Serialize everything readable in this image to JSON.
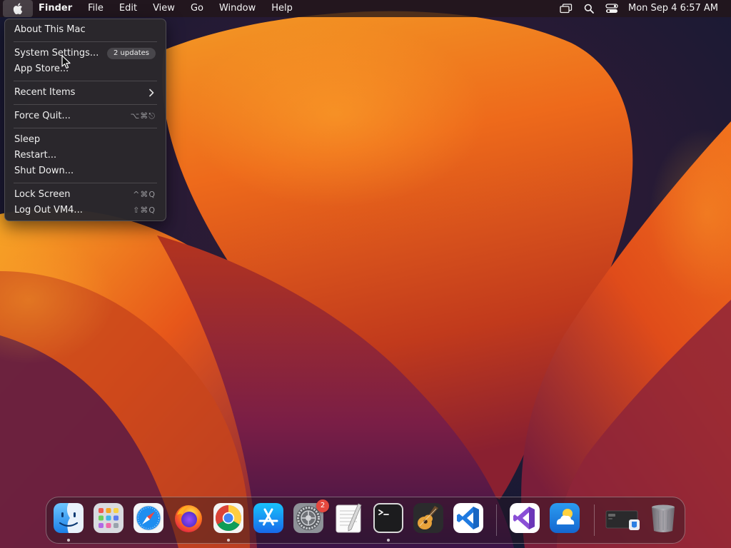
{
  "menubar": {
    "apple_icon": "apple-logo-icon",
    "app_name": "Finder",
    "menus": [
      "File",
      "Edit",
      "View",
      "Go",
      "Window",
      "Help"
    ],
    "status_icons": [
      "screen-mirroring-icon",
      "spotlight-search-icon",
      "control-center-icon"
    ],
    "clock": "Mon Sep 4  6:57 AM"
  },
  "apple_menu": {
    "about": "About This Mac",
    "system_settings": {
      "label": "System Settings...",
      "badge": "2 updates"
    },
    "app_store": "App Store...",
    "recent_items": {
      "label": "Recent Items",
      "icon": "chevron-right-icon"
    },
    "force_quit": {
      "label": "Force Quit...",
      "shortcut": "⌥⌘⎋"
    },
    "sleep": "Sleep",
    "restart": "Restart...",
    "shut_down": "Shut Down...",
    "lock_screen": {
      "label": "Lock Screen",
      "shortcut": "^⌘Q"
    },
    "log_out": {
      "label": "Log Out VM4...",
      "shortcut": "⇧⌘Q"
    }
  },
  "dock": {
    "apps": [
      {
        "name": "Finder",
        "icon": "finder-icon",
        "running": true
      },
      {
        "name": "Launchpad",
        "icon": "launchpad-icon",
        "running": false
      },
      {
        "name": "Safari",
        "icon": "safari-icon",
        "running": false
      },
      {
        "name": "Firefox",
        "icon": "firefox-icon",
        "running": false
      },
      {
        "name": "Google Chrome",
        "icon": "chrome-icon",
        "running": true
      },
      {
        "name": "App Store",
        "icon": "app-store-icon",
        "running": false
      },
      {
        "name": "System Settings",
        "icon": "system-settings-icon",
        "running": false,
        "badge": "2"
      },
      {
        "name": "TextEdit",
        "icon": "textedit-icon",
        "running": false
      },
      {
        "name": "Terminal",
        "icon": "terminal-icon",
        "running": true
      },
      {
        "name": "GarageBand",
        "icon": "garageband-icon",
        "running": false
      },
      {
        "name": "Visual Studio Code",
        "icon": "vscode-icon",
        "running": false
      },
      {
        "name": "Visual Studio",
        "icon": "visual-studio-icon",
        "running": false
      },
      {
        "name": "Weather",
        "icon": "weather-icon",
        "running": false
      },
      {
        "name": "Downloads",
        "icon": "downloads-stack-icon",
        "running": false
      },
      {
        "name": "Trash",
        "icon": "trash-icon",
        "running": false
      }
    ]
  },
  "colors": {
    "menu_background": "#2a282c",
    "badge_red": "#e5483e",
    "accent_blue": "#1f7ae0"
  }
}
